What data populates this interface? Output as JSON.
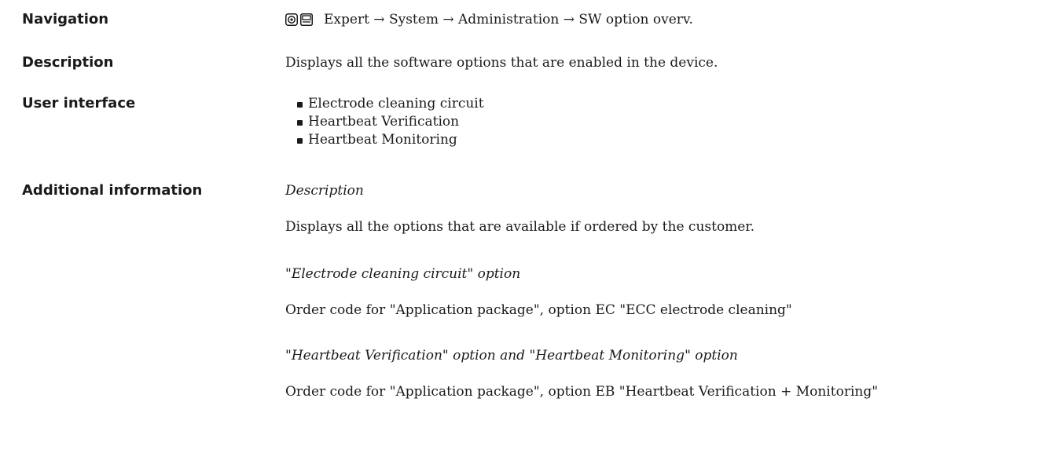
{
  "navigation": {
    "label": "Navigation",
    "icons": [
      "display-keypad-icon",
      "display-icon"
    ],
    "path": "Expert → System → Administration → SW option overv."
  },
  "description": {
    "label": "Description",
    "text": "Displays all the software options that are enabled in the device."
  },
  "user_interface": {
    "label": "User interface",
    "items": [
      "Electrode cleaning circuit",
      "Heartbeat Verification",
      "Heartbeat Monitoring"
    ]
  },
  "additional_information": {
    "label": "Additional information",
    "description_heading": "Description",
    "description_text": "Displays all the options that are available if ordered by the customer.",
    "sections": [
      {
        "heading": "\"Electrode cleaning circuit\" option",
        "text": "Order code for \"Application package\", option EC \"ECC electrode cleaning\""
      },
      {
        "heading": "\"Heartbeat Verification\" option and \"Heartbeat Monitoring\" option",
        "text": "Order code for \"Application package\", option EB \"Heartbeat Verification + Monitoring\""
      }
    ]
  }
}
